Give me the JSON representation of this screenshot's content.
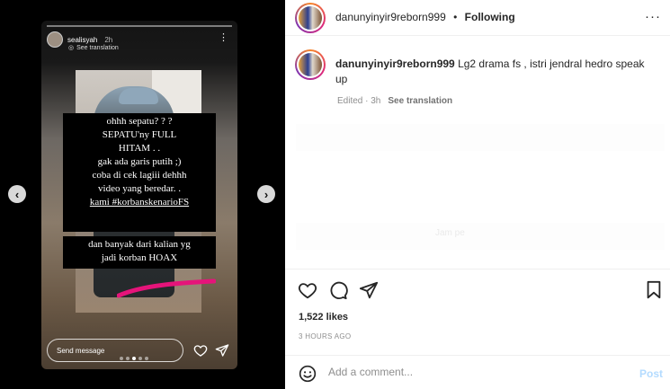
{
  "story": {
    "username": "sealisyah",
    "time": "2h",
    "see_translation": "See translation",
    "caption_lines": [
      "ohhh sepatu? ? ?",
      "SEPATU'ny FULL",
      "HITAM . .",
      "gak ada garis putih ;)",
      "coba di cek lagiii dehhh",
      "video yang beredar. .",
      "kami #korbanskenarioFS"
    ],
    "caption2_lines": [
      "dan banyak dari kalian yg",
      "jadi korban HOAX"
    ],
    "send_message_placeholder": "Send message"
  },
  "nav": {
    "prev": "‹",
    "next": "›"
  },
  "header": {
    "username": "danunyinyir9reborn999",
    "dot": "•",
    "following": "Following",
    "more": "···"
  },
  "caption": {
    "username": "danunyinyir9reborn999",
    "text": "Lg2 drama fs , istri jendral hedro speak up",
    "edited": "Edited · 3h",
    "see_translation": "See translation"
  },
  "faded_comment": "Jam pe",
  "likes": "1,522 likes",
  "posted_ago": "3 HOURS AGO",
  "comment_box": {
    "placeholder": "Add a comment...",
    "post_label": "Post"
  },
  "icons": [
    "more-icon",
    "translate-icon",
    "heart-icon",
    "send-icon",
    "chevron-left-icon",
    "chevron-right-icon",
    "comment-icon",
    "share-icon",
    "bookmark-icon",
    "emoji-icon"
  ],
  "colors": {
    "post_button": "#b3dbff",
    "ring_start": "#f58529",
    "ring_mid": "#dd2a7b",
    "ring_end": "#8134af",
    "highlight_stroke": "#e5147a"
  }
}
